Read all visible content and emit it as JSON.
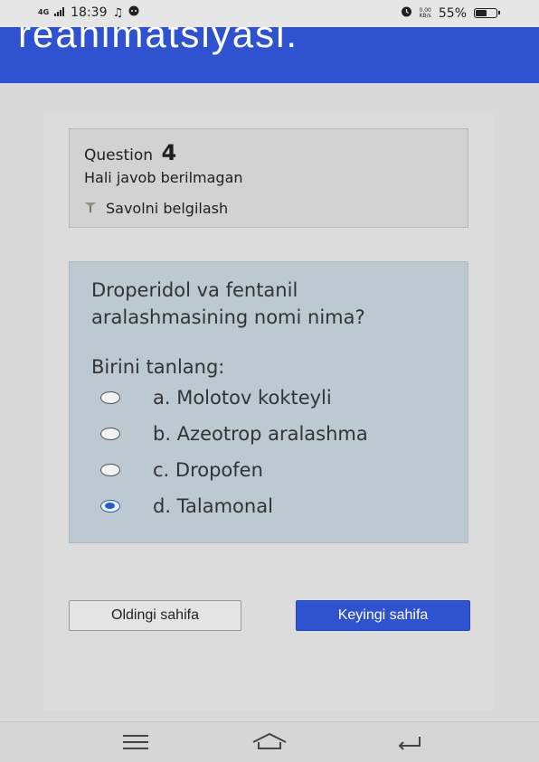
{
  "status_bar": {
    "network": "4G",
    "time": "18:39",
    "music_icon": "music-note-icon",
    "chat_icon": "chat-bubble-icon",
    "alarm_icon": "alarm-icon",
    "speed_value": "0.00",
    "speed_unit": "KB/s",
    "battery_percent": "55%",
    "battery_level": 0.55
  },
  "header": {
    "title": "reanimatsiyasi."
  },
  "question_info": {
    "label": "Question",
    "number": "4",
    "status": "Hali javob berilmagan",
    "flag_label": "Savolni belgilash",
    "flag_icon": "flag-icon"
  },
  "question": {
    "text": "Droperidol va fentanil aralashmasining nomi nima?",
    "prompt": "Birini tanlang:",
    "options": [
      {
        "label": "a. Molotov kokteyli",
        "checked": false
      },
      {
        "label": "b. Azeotrop aralashma",
        "checked": false
      },
      {
        "label": "c. Dropofen",
        "checked": false
      },
      {
        "label": "d. Talamonal",
        "checked": true
      }
    ]
  },
  "navigation": {
    "prev_label": "Oldingi sahifa",
    "next_label": "Keyingi sahifa"
  },
  "system_nav": {
    "menu_icon": "menu-icon",
    "home_icon": "home-icon",
    "back_icon": "back-icon"
  },
  "colors": {
    "accent": "#2f52d1",
    "radio_selected": "#1a5fd8",
    "question_bg": "#bdc9d0"
  }
}
